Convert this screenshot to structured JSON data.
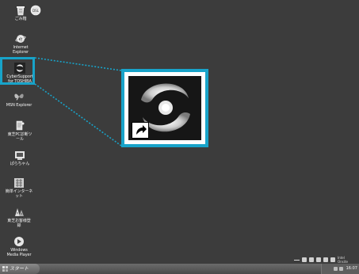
{
  "desktop": {
    "icons": [
      {
        "label": "ごみ箱",
        "icon": "recycle-bin-icon"
      },
      {
        "label": "",
        "icon": "internet-connection-icon"
      },
      {
        "label": "Internet\nExplorer",
        "icon": "internet-explorer-icon"
      },
      {
        "label": "CyberSupport\nfor TOSHIBA",
        "icon": "cybersupport-icon"
      },
      {
        "label": "MSN Explorer",
        "icon": "msn-butterfly-icon"
      },
      {
        "label": "東芝PC診断ツ\nール",
        "icon": "pc-diagnostic-icon"
      },
      {
        "label": "ぱらちゃん",
        "icon": "parachan-icon"
      },
      {
        "label": "簡単インターネ\nット",
        "icon": "easy-internet-icon"
      },
      {
        "label": "東芝お客様登\n録",
        "icon": "customer-registration-icon"
      },
      {
        "label": "Windows\nMedia Player",
        "icon": "media-player-icon"
      }
    ]
  },
  "taskbar": {
    "start_label": "スタート",
    "clock": "16:07",
    "tray_label": "Intel\nOnsite"
  },
  "colors": {
    "highlight": "#18a3c9",
    "desktop_bg": "#3c3c3c"
  }
}
